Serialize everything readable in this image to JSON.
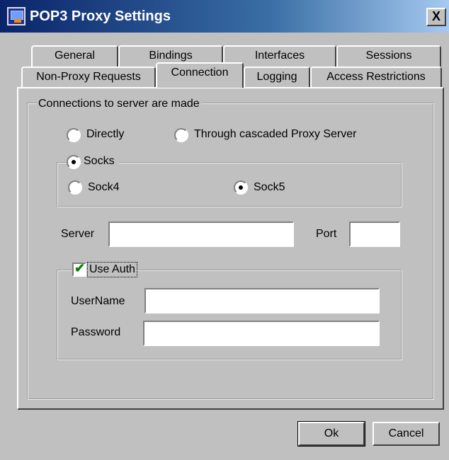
{
  "window": {
    "title": "POP3 Proxy Settings",
    "close_label": "X"
  },
  "tabs": {
    "row1": [
      "General",
      "Bindings",
      "Interfaces",
      "Sessions"
    ],
    "row2": [
      "Non-Proxy Requests",
      "Connection",
      "Logging",
      "Access Restrictions"
    ],
    "active": "Connection"
  },
  "connection": {
    "group_label": "Connections to server are made",
    "directly_label": "Directly",
    "cascaded_label": "Through cascaded Proxy Server",
    "socks_label": "Socks",
    "sock4_label": "Sock4",
    "sock5_label": "Sock5",
    "server_label": "Server",
    "server_value": "",
    "port_label": "Port",
    "port_value": "",
    "use_auth_label": "Use Auth",
    "use_auth_checked": true,
    "username_label": "UserName",
    "username_value": "",
    "password_label": "Password",
    "password_value": ""
  },
  "buttons": {
    "ok": "Ok",
    "cancel": "Cancel"
  }
}
